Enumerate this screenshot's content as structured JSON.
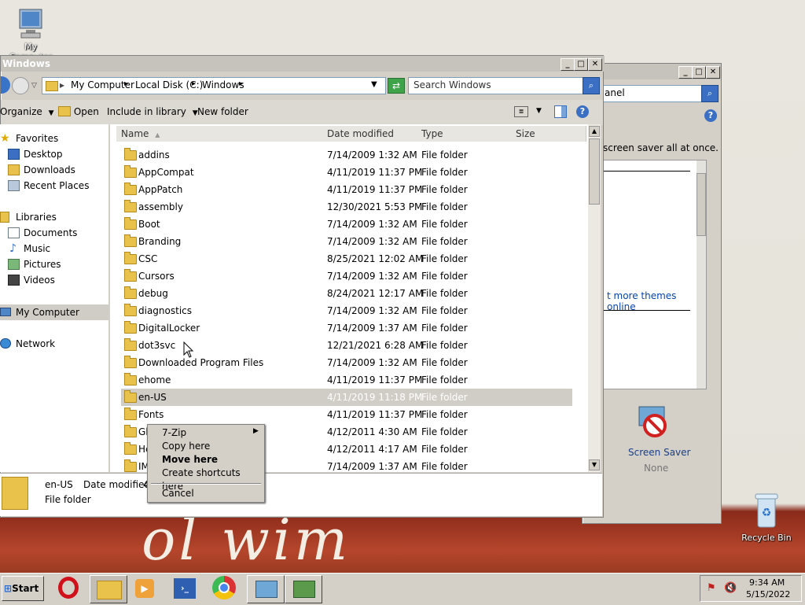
{
  "desktop": {
    "icons": [
      {
        "label": "My Computer"
      },
      {
        "label": "Recycle Bin"
      }
    ],
    "wallpaper_text": "ol wim"
  },
  "back_window": {
    "search_text": "anel",
    "description": "screen saver all at once.",
    "themes_link": "t more themes online",
    "screen_saver": {
      "label": "Screen Saver",
      "value": "None"
    }
  },
  "explorer": {
    "title": "Windows",
    "breadcrumb": [
      "My Computer",
      "Local Disk (C:)",
      "Windows"
    ],
    "search_placeholder": "Search Windows",
    "toolbar": {
      "organize": "Organize",
      "open": "Open",
      "include": "Include in library",
      "new_folder": "New folder"
    },
    "nav": {
      "favorites": "Favorites",
      "desktop": "Desktop",
      "downloads": "Downloads",
      "recent": "Recent Places",
      "libraries": "Libraries",
      "documents": "Documents",
      "music": "Music",
      "pictures": "Pictures",
      "videos": "Videos",
      "my_computer": "My Computer",
      "network": "Network"
    },
    "columns": {
      "name": "Name",
      "date": "Date modified",
      "type": "Type",
      "size": "Size"
    },
    "rows": [
      {
        "name": "addins",
        "date": "7/14/2009 1:32 AM",
        "type": "File folder"
      },
      {
        "name": "AppCompat",
        "date": "4/11/2019 11:37 PM",
        "type": "File folder"
      },
      {
        "name": "AppPatch",
        "date": "4/11/2019 11:37 PM",
        "type": "File folder"
      },
      {
        "name": "assembly",
        "date": "12/30/2021 5:53 PM",
        "type": "File folder"
      },
      {
        "name": "Boot",
        "date": "7/14/2009 1:32 AM",
        "type": "File folder"
      },
      {
        "name": "Branding",
        "date": "7/14/2009 1:32 AM",
        "type": "File folder"
      },
      {
        "name": "CSC",
        "date": "8/25/2021 12:02 AM",
        "type": "File folder"
      },
      {
        "name": "Cursors",
        "date": "7/14/2009 1:32 AM",
        "type": "File folder"
      },
      {
        "name": "debug",
        "date": "8/24/2021 12:17 AM",
        "type": "File folder"
      },
      {
        "name": "diagnostics",
        "date": "7/14/2009 1:32 AM",
        "type": "File folder"
      },
      {
        "name": "DigitalLocker",
        "date": "7/14/2009 1:37 AM",
        "type": "File folder"
      },
      {
        "name": "dot3svc",
        "date": "12/21/2021 6:28 AM",
        "type": "File folder"
      },
      {
        "name": "Downloaded Program Files",
        "date": "7/14/2009 1:32 AM",
        "type": "File folder"
      },
      {
        "name": "ehome",
        "date": "4/11/2019 11:37 PM",
        "type": "File folder"
      },
      {
        "name": "en-US",
        "date": "4/11/2019 11:18 PM",
        "type": "File folder"
      },
      {
        "name": "Fonts",
        "date": "4/11/2019 11:37 PM",
        "type": "File folder"
      },
      {
        "name": "Gl",
        "date": "4/12/2011 4:30 AM",
        "type": "File folder"
      },
      {
        "name": "He",
        "date": "4/12/2011 4:17 AM",
        "type": "File folder"
      },
      {
        "name": "IM",
        "date": "7/14/2009 1:37 AM",
        "type": "File folder"
      }
    ],
    "details": {
      "name": "en-US",
      "date_label": "Date modified:",
      "date_value": "4",
      "type": "File folder"
    }
  },
  "context_menu": {
    "items": [
      "7-Zip",
      "Copy here",
      "Move here",
      "Create shortcuts here",
      "Cancel"
    ]
  },
  "taskbar": {
    "start": "Start",
    "time": "9:34 AM",
    "date": "5/15/2022"
  }
}
